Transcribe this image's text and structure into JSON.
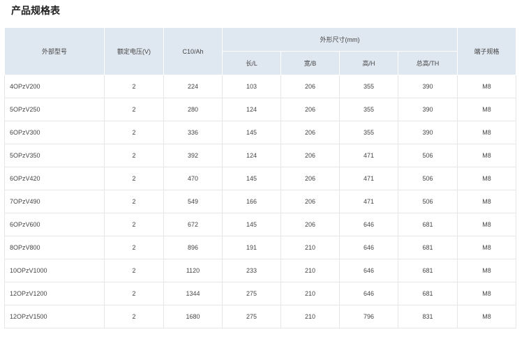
{
  "title": "产品规格表",
  "table": {
    "headers": {
      "model": "外部型号",
      "voltage": "额定电压(V)",
      "capacity": "C10/Ah",
      "dimensions": "外形尺寸(mm)",
      "length": "长/L",
      "width": "宽/B",
      "height": "高/H",
      "total_height": "总高/TH",
      "terminal": "端子规格"
    },
    "rows": [
      {
        "model": "4OPzV200",
        "voltage": "2",
        "capacity": "224",
        "length": "103",
        "width": "206",
        "height": "355",
        "total_height": "390",
        "terminal": "M8"
      },
      {
        "model": "5OPzV250",
        "voltage": "2",
        "capacity": "280",
        "length": "124",
        "width": "206",
        "height": "355",
        "total_height": "390",
        "terminal": "M8"
      },
      {
        "model": "6OPzV300",
        "voltage": "2",
        "capacity": "336",
        "length": "145",
        "width": "206",
        "height": "355",
        "total_height": "390",
        "terminal": "M8"
      },
      {
        "model": "5OPzV350",
        "voltage": "2",
        "capacity": "392",
        "length": "124",
        "width": "206",
        "height": "471",
        "total_height": "506",
        "terminal": "M8"
      },
      {
        "model": "6OPzV420",
        "voltage": "2",
        "capacity": "470",
        "length": "145",
        "width": "206",
        "height": "471",
        "total_height": "506",
        "terminal": "M8"
      },
      {
        "model": "7OPzV490",
        "voltage": "2",
        "capacity": "549",
        "length": "166",
        "width": "206",
        "height": "471",
        "total_height": "506",
        "terminal": "M8"
      },
      {
        "model": "6OPzV600",
        "voltage": "2",
        "capacity": "672",
        "length": "145",
        "width": "206",
        "height": "646",
        "total_height": "681",
        "terminal": "M8"
      },
      {
        "model": "8OPzV800",
        "voltage": "2",
        "capacity": "896",
        "length": "191",
        "width": "210",
        "height": "646",
        "total_height": "681",
        "terminal": "M8"
      },
      {
        "model": "10OPzV1000",
        "voltage": "2",
        "capacity": "1120",
        "length": "233",
        "width": "210",
        "height": "646",
        "total_height": "681",
        "terminal": "M8"
      },
      {
        "model": "12OPzV1200",
        "voltage": "2",
        "capacity": "1344",
        "length": "275",
        "width": "210",
        "height": "646",
        "total_height": "681",
        "terminal": "M8"
      },
      {
        "model": "12OPzV1500",
        "voltage": "2",
        "capacity": "1680",
        "length": "275",
        "width": "210",
        "height": "796",
        "total_height": "831",
        "terminal": "M8"
      }
    ]
  }
}
